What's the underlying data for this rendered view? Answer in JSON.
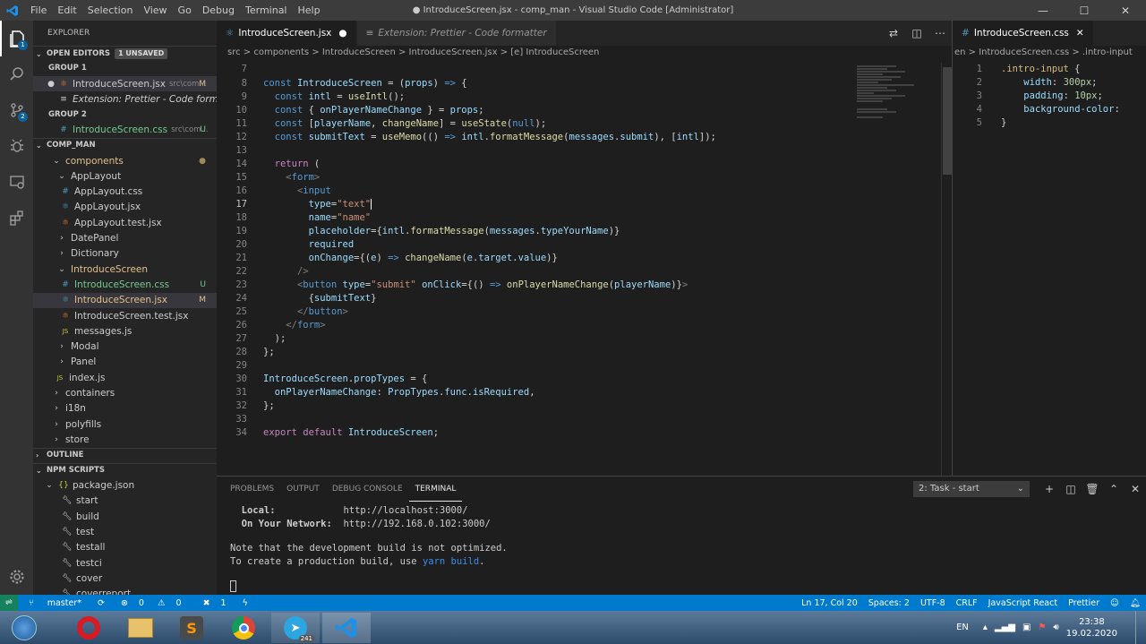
{
  "titlebar": {
    "menu": [
      "File",
      "Edit",
      "Selection",
      "View",
      "Go",
      "Debug",
      "Terminal",
      "Help"
    ],
    "title": "● IntroduceScreen.jsx - comp_man - Visual Studio Code [Administrator]"
  },
  "activity": {
    "explorer_badge": "1",
    "scm_badge": "2"
  },
  "sidebar": {
    "title": "EXPLORER",
    "open_editors": "OPEN EDITORS",
    "unsaved": "1 UNSAVED",
    "group1": "GROUP 1",
    "group2": "GROUP 2",
    "oe": [
      {
        "dot": "●",
        "name": "IntroduceScreen.jsx",
        "desc": "src\\com...",
        "st": "M"
      },
      {
        "name": "Extension: Prettier - Code formatter"
      },
      {
        "name": "IntroduceScreen.css",
        "desc": "src\\com...",
        "st": "U"
      }
    ],
    "project": "COMP_MAN",
    "tree": [
      {
        "name": "components",
        "st": "●"
      },
      {
        "name": "AppLayout"
      },
      {
        "name": "AppLayout.css"
      },
      {
        "name": "AppLayout.jsx"
      },
      {
        "name": "AppLayout.test.jsx"
      },
      {
        "name": "DatePanel"
      },
      {
        "name": "Dictionary"
      },
      {
        "name": "IntroduceScreen"
      },
      {
        "name": "IntroduceScreen.css",
        "st": "U"
      },
      {
        "name": "IntroduceScreen.jsx",
        "st": "M"
      },
      {
        "name": "IntroduceScreen.test.jsx"
      },
      {
        "name": "messages.js"
      },
      {
        "name": "Modal"
      },
      {
        "name": "Panel"
      },
      {
        "name": "index.js"
      },
      {
        "name": "containers"
      },
      {
        "name": "i18n"
      },
      {
        "name": "polyfills"
      },
      {
        "name": "store"
      }
    ],
    "outline": "OUTLINE",
    "npm": "NPM SCRIPTS",
    "scripts": [
      "package.json",
      "start",
      "build",
      "test",
      "testall",
      "testci",
      "cover",
      "coverreport"
    ]
  },
  "editor1": {
    "tab_active": "IntroduceScreen.jsx",
    "tab_other": "Extension: Prettier - Code formatter",
    "crumbs": "src > components > IntroduceScreen > IntroduceScreen.jsx > [e] IntroduceScreen",
    "lines": [
      "7",
      "8",
      "9",
      "10",
      "11",
      "12",
      "13",
      "14",
      "15",
      "16",
      "17",
      "18",
      "19",
      "20",
      "21",
      "22",
      "23",
      "24",
      "25",
      "26",
      "27",
      "28",
      "29",
      "30",
      "31",
      "32",
      "33",
      "34"
    ]
  },
  "editor2": {
    "tab": "IntroduceScreen.css",
    "crumbs": "en > IntroduceScreen.css > .intro-input",
    "lines": [
      "1",
      "2",
      "3",
      "4",
      "5"
    ]
  },
  "panel": {
    "tabs": [
      "PROBLEMS",
      "OUTPUT",
      "DEBUG CONSOLE",
      "TERMINAL"
    ],
    "task": "2: Task - start",
    "term": {
      "l1a": "  Local:            ",
      "l1b": "http://localhost:3000/",
      "l2a": "  On Your Network:  ",
      "l2b": "http://192.168.0.102:3000/",
      "l3": "Note that the development build is not optimized.",
      "l4a": "To create a production build, use ",
      "l4b": "yarn build",
      "l4c": "."
    }
  },
  "status": {
    "branch": "master*",
    "errors": "0",
    "warnings": "0",
    "x": "1",
    "pos": "Ln 17, Col 20",
    "spaces": "Spaces: 2",
    "enc": "UTF-8",
    "eol": "CRLF",
    "lang": "JavaScript React",
    "fmt": "Prettier"
  },
  "taskbar": {
    "lang": "EN",
    "time": "23:38",
    "date": "19.02.2020",
    "tg_badge": "241"
  }
}
